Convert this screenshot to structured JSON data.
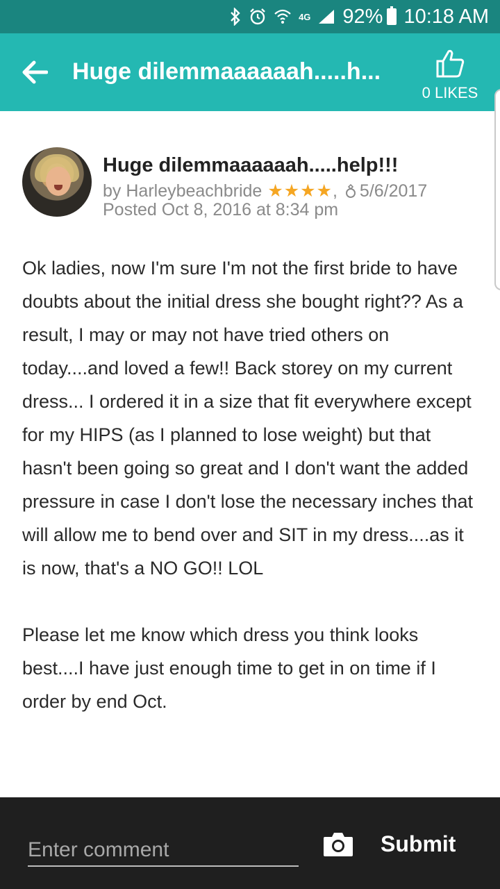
{
  "status_bar": {
    "network": "4G",
    "battery": "92%",
    "time": "10:18 AM"
  },
  "app_bar": {
    "title": "Huge dilemmaaaaaah.....h...",
    "likes_label": "0 LIKES"
  },
  "post": {
    "title": "Huge dilemmaaaaaah.....help!!!",
    "author_prefix": "by",
    "author": "Harleybeachbride",
    "stars": "★★★★",
    "wedding_date": "5/6/2017",
    "posted": "Posted Oct 8, 2016 at 8:34 pm",
    "paragraphs": [
      "Ok ladies, now I'm sure I'm not the first bride to have doubts about the initial dress she bought right?? As a result, I may or may not have tried others on today....and loved a few!! Back storey on my current dress... I ordered it in a size that fit everywhere except for my HIPS (as I planned to lose weight) but that hasn't been going so great and I don't want the added pressure in case I don't lose the necessary inches that will allow me to bend over and SIT in my dress....as it is now, that's a NO GO!! LOL",
      "Please let me know which dress you think looks best....I have just enough time to get in on time if I order by end Oct."
    ]
  },
  "comment_bar": {
    "placeholder": "Enter comment",
    "submit_label": "Submit"
  },
  "colors": {
    "status_bar": "#1a857f",
    "app_bar": "#24b8b2",
    "stars": "#f5a623",
    "comment_bar": "#1f1f1f"
  },
  "icons": [
    "bluetooth-icon",
    "alarm-icon",
    "wifi-icon",
    "signal-icon",
    "battery-icon",
    "back-arrow-icon",
    "thumbs-up-icon",
    "ring-icon",
    "camera-icon"
  ]
}
